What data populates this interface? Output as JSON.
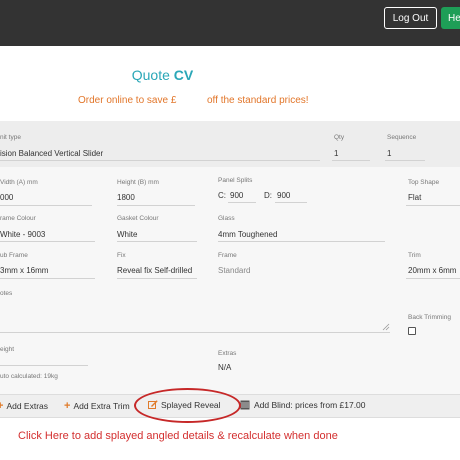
{
  "header": {
    "logout_label": "Log Out",
    "help_label": "He"
  },
  "quote": {
    "title_prefix": "Quote",
    "title_code": "CV",
    "promo_left": "Order online to save £",
    "promo_right": "off the standard prices!"
  },
  "form": {
    "unit_type": {
      "label": "nit type",
      "value": "ision Balanced Vertical Slider"
    },
    "qty": {
      "label": "Qty",
      "value": "1"
    },
    "sequence": {
      "label": "Sequence",
      "value": "1"
    },
    "width": {
      "label": "Vidth (A) mm",
      "value": "000"
    },
    "height": {
      "label": "Height (B) mm",
      "value": "1800"
    },
    "panel_splits": {
      "label": "Panel Splits",
      "c_label": "C:",
      "c_value": "900",
      "d_label": "D:",
      "d_value": "900"
    },
    "top_shape": {
      "label": "Top Shape",
      "value": "Flat"
    },
    "frame_colour": {
      "label": "rame Colour",
      "value": "White - 9003"
    },
    "gasket_colour": {
      "label": "Gasket Colour",
      "value": "White"
    },
    "glass": {
      "label": "Glass",
      "value": "4mm Toughened"
    },
    "sub_frame": {
      "label": "ub Frame",
      "value": "3mm x 16mm"
    },
    "fix": {
      "label": "Fix",
      "value": "Reveal fix Self-drilled"
    },
    "frame": {
      "label": "Frame",
      "value": "Standard"
    },
    "trim": {
      "label": "Trim",
      "value": "20mm x 6mm"
    },
    "notes": {
      "label": "otes",
      "value": ""
    },
    "back_trimming": {
      "label": "Back Trimming",
      "checked": false
    },
    "weight": {
      "label": "eight",
      "note": "uto calculated: 19kg"
    },
    "extras": {
      "label": "Extras",
      "value": "N/A"
    }
  },
  "toolbar": {
    "add_extras": "Add Extras",
    "add_extra_trim": "Add Extra Trim",
    "splayed_reveal": "Splayed Reveal",
    "add_blind": "Add Blind: prices from £17.00"
  },
  "annotation": {
    "instruction": "Click Here to add splayed angled details & recalculate when done"
  },
  "colors": {
    "topbar": "#333333",
    "help_button": "#1e9e57",
    "title": "#2aa7b7",
    "promo": "#e2762a",
    "plus_icon": "#e07b2a",
    "annotation_red": "#d32f2f"
  }
}
